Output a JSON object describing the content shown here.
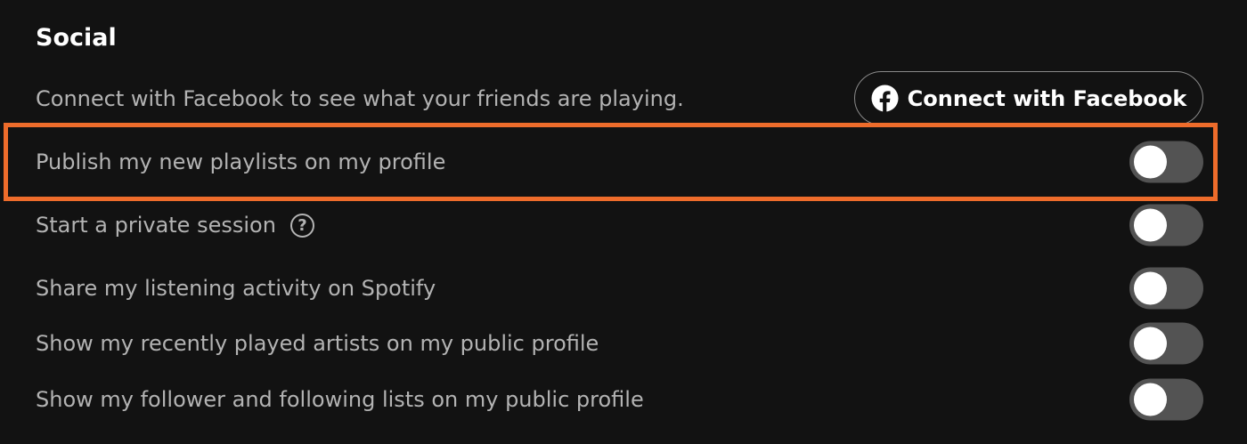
{
  "section": {
    "title": "Social"
  },
  "facebook": {
    "description": "Connect with Facebook to see what your friends are playing.",
    "button_label": "Connect with Facebook",
    "button_icon": "facebook-icon"
  },
  "settings": [
    {
      "label": "Publish my new playlists on my profile",
      "enabled": false
    },
    {
      "label": "Start a private session",
      "enabled": false,
      "help_icon": "question-mark-circle-icon",
      "help_glyph": "?"
    },
    {
      "label": "Share my listening activity on Spotify",
      "enabled": false
    },
    {
      "label": "Show my recently played artists on my public profile",
      "enabled": false
    },
    {
      "label": "Show my follower and following lists on my public profile",
      "enabled": false
    }
  ],
  "colors": {
    "background": "#121212",
    "primary_text": "#ffffff",
    "secondary_text": "#b3b3b3",
    "toggle_off_track": "#535353",
    "toggle_knob": "#ffffff",
    "highlight": "#ee6c2b"
  }
}
